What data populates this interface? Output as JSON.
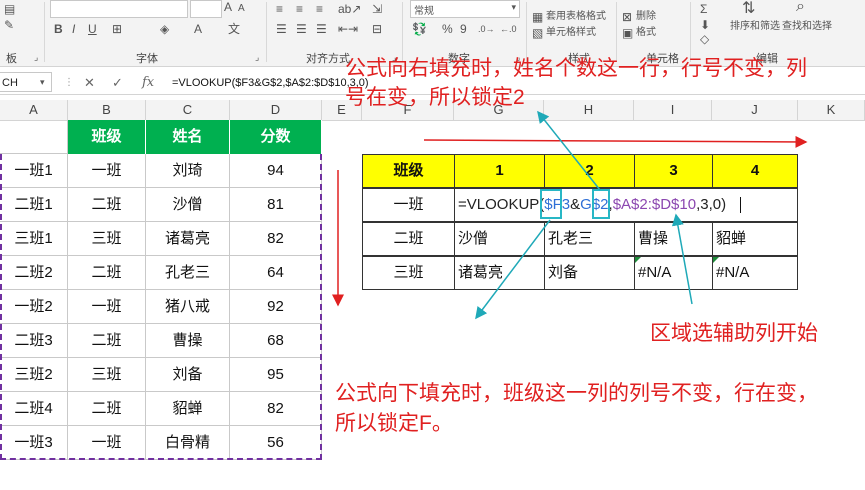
{
  "ribbon": {
    "groups": [
      "板",
      "字体",
      "对齐方式",
      "数字",
      "样式",
      "单元格",
      "编辑"
    ],
    "number_format": "常规",
    "styles_items": [
      "套用表格格式",
      "单元格样式"
    ],
    "cells_items": [
      "删除",
      "格式"
    ],
    "edit_items": [
      "排序和筛选",
      "查找和选择"
    ],
    "font_size_up": "A",
    "font_size_down": "A",
    "percent_symbol": "%",
    "comma_symbol": "9"
  },
  "formula_bar": {
    "name_box": "CH",
    "cancel": "✕",
    "enter": "✓",
    "fx": "fx",
    "formula": "=VLOOKUP($F3&G$2,$A$2:$D$10,3,0)"
  },
  "columns": [
    "A",
    "B",
    "C",
    "D",
    "E",
    "F",
    "G",
    "H",
    "I",
    "J",
    "K"
  ],
  "left_table": {
    "headers": [
      "班级",
      "姓名",
      "分数"
    ],
    "rows": [
      [
        "一班1",
        "一班",
        "刘琦",
        "94"
      ],
      [
        "二班1",
        "二班",
        "沙僧",
        "81"
      ],
      [
        "三班1",
        "三班",
        "诸葛亮",
        "82"
      ],
      [
        "二班2",
        "二班",
        "孔老三",
        "64"
      ],
      [
        "一班2",
        "一班",
        "猪八戒",
        "92"
      ],
      [
        "二班3",
        "二班",
        "曹操",
        "68"
      ],
      [
        "三班2",
        "三班",
        "刘备",
        "95"
      ],
      [
        "二班4",
        "二班",
        "貂蝉",
        "82"
      ],
      [
        "一班3",
        "一班",
        "白骨精",
        "56"
      ]
    ]
  },
  "right_table": {
    "header_label": "班级",
    "header_numbers": [
      "1",
      "2",
      "3",
      "4"
    ],
    "row1_label": "一班",
    "formula_parts": [
      "=VLOOKUP(",
      "$F3",
      "&",
      "G$2",
      ",",
      "$A$2:$D$10",
      ",3,0)"
    ],
    "rows": [
      [
        "二班",
        "沙僧",
        "孔老三",
        "曹操",
        "貂蝉"
      ],
      [
        "三班",
        "诸葛亮",
        "刘备",
        "#N/A",
        "#N/A"
      ]
    ]
  },
  "annotations": {
    "right_fill_line1": "公式向右填充时，姓名个数这一行，行号不变，列",
    "right_fill_line2": "号在变，所以锁定2",
    "helper_column": "区域选辅助列开始",
    "down_fill_line1": "公式向下填充时，班级这一列的列号不变，行在变，",
    "down_fill_line2": "所以锁定F。"
  },
  "colors": {
    "header_green": "#00b050",
    "header_yellow": "#ffff00",
    "annotation_red": "#e02020",
    "highlight_cyan": "#28b7c5",
    "outline_purple": "#7030a0"
  }
}
